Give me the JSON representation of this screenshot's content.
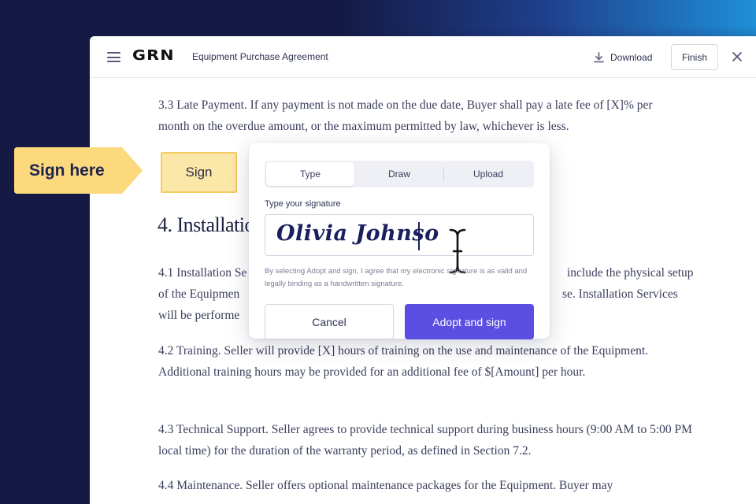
{
  "header": {
    "logo": "GRN",
    "title": "Equipment Purchase Agreement",
    "download_label": "Download",
    "finish_label": "Finish",
    "icons": [
      "menu-icon",
      "download-icon",
      "close-icon"
    ]
  },
  "document": {
    "p33": "3.3 Late Payment. If any payment is not made on the due date, Buyer shall pay a late fee of [X]% per month on the overdue amount, or the maximum permitted by law, whichever is less.",
    "heading4": "4. Installatio",
    "p41_line1_left": "4.1 Installation Se",
    "p41_line1_right": "include the physical setup",
    "p41_line2_left": "of the Equipmen",
    "p41_line2_right": "se. Installation Services",
    "p41_line3_left": "will be performe",
    "p42": "4.2 Training. Seller will provide [X] hours of training on the use and maintenance of the Equipment. Additional training hours may be provided for an additional fee of $[Amount] per hour.",
    "p43": "4.3 Technical Support. Seller agrees to provide technical support during business hours (9:00 AM to 5:00 PM local time) for the duration of the warranty period, as defined in Section 7.2.",
    "p44": "4.4 Maintenance. Seller offers optional maintenance packages for the Equipment. Buyer may"
  },
  "sign_here": {
    "flag_label": "Sign here",
    "field_label": "Sign"
  },
  "signature_modal": {
    "tabs": [
      {
        "label": "Type",
        "active": true
      },
      {
        "label": "Draw",
        "active": false
      },
      {
        "label": "Upload",
        "active": false
      }
    ],
    "field_label": "Type your signature",
    "signature_value": "Olivia Johnso",
    "legal_text": "By selecting Adopt and sign, I agree that my electronic signature is as valid and legally binding as a handwritten signature.",
    "cancel_label": "Cancel",
    "adopt_label": "Adopt and sign"
  },
  "colors": {
    "accent": "#5b4ee2",
    "sign_flag": "#fcd97d",
    "sign_field": "#fbe7a8",
    "signature_ink": "#1a1f5e"
  }
}
